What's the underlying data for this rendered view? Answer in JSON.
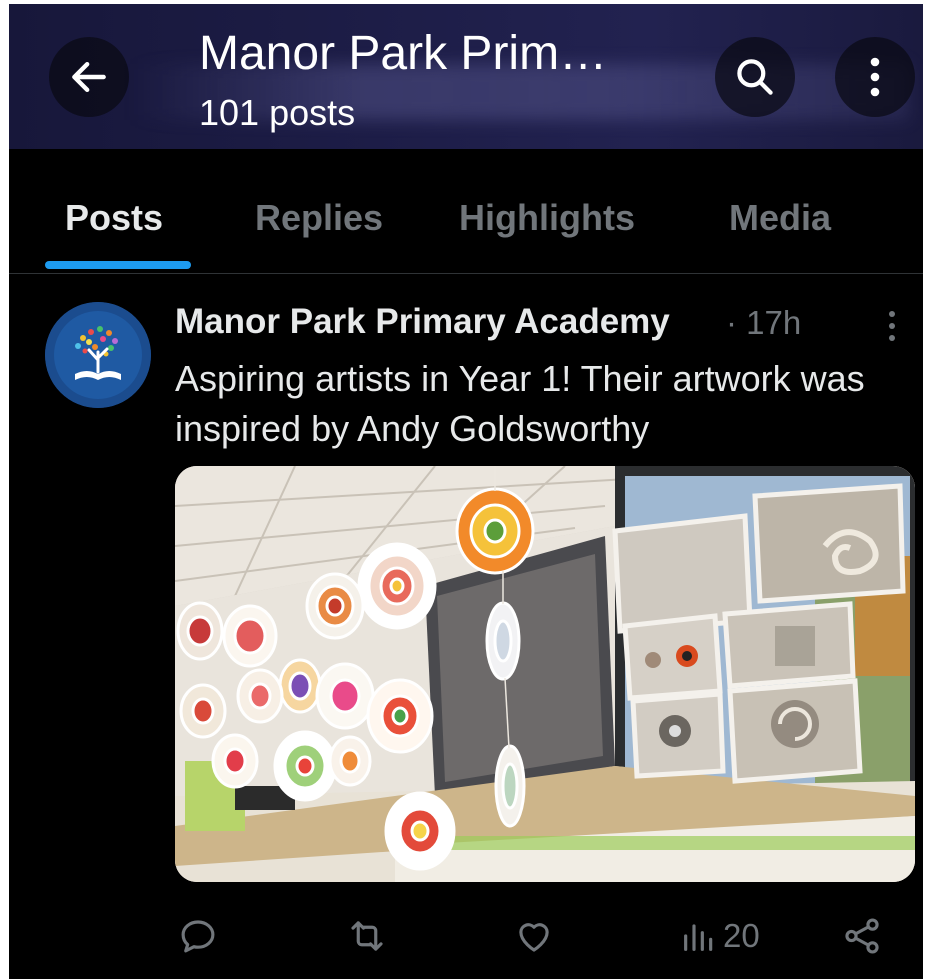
{
  "header": {
    "title": "Manor Park Prim…",
    "post_count": "101 posts",
    "back_icon": "arrow-left-icon",
    "search_icon": "search-icon",
    "more_icon": "more-vertical-icon"
  },
  "tabs": [
    {
      "label": "Posts",
      "active": true
    },
    {
      "label": "Replies",
      "active": false
    },
    {
      "label": "Highlights",
      "active": false
    },
    {
      "label": "Media",
      "active": false
    }
  ],
  "post": {
    "author": "Manor Park Primary Academy",
    "meta": "· 17h",
    "text": "Aspiring artists in Year 1! Their artwork was inspired by Andy Goldsworthy",
    "actions": {
      "reply_icon": "reply-icon",
      "repost_icon": "repost-icon",
      "like_icon": "heart-icon",
      "views_icon": "analytics-icon",
      "views_count": "20",
      "share_icon": "share-icon"
    }
  },
  "colors": {
    "background": "#000000",
    "accent": "#1d9bf0",
    "primary_text": "#e7e9ea",
    "secondary_text": "#71767b"
  }
}
